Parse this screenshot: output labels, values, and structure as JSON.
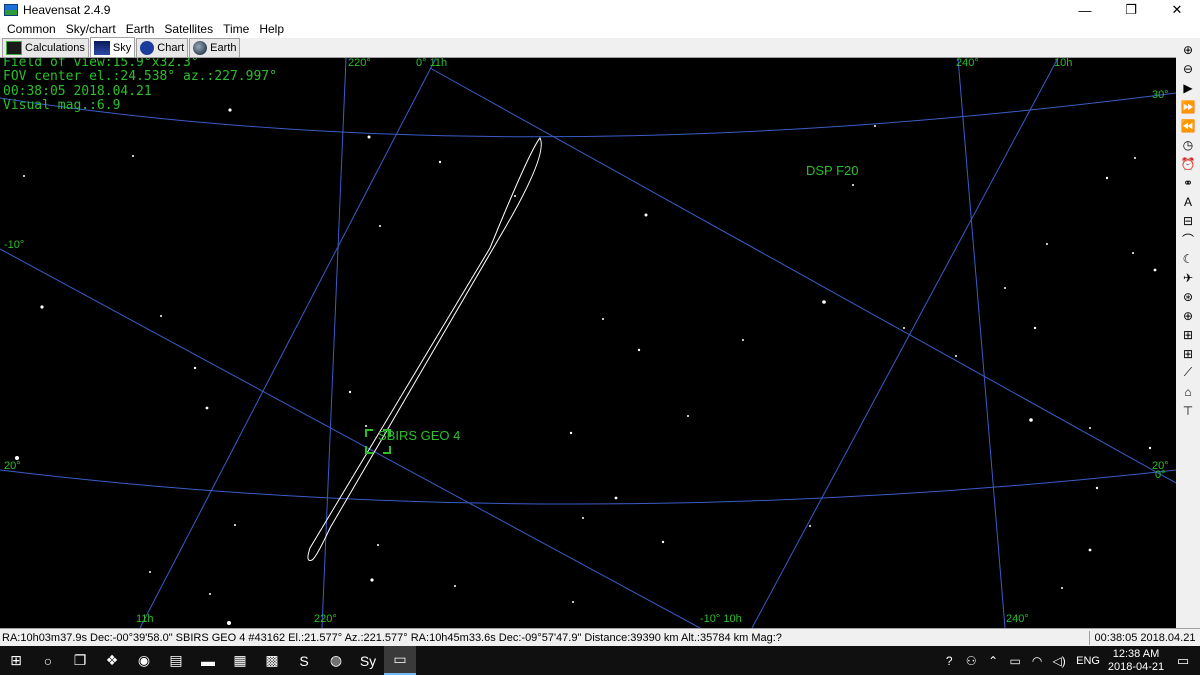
{
  "window": {
    "title": "Heavensat 2.4.9",
    "minimize_glyph": "—",
    "restore_glyph": "❐",
    "close_glyph": "✕"
  },
  "menu": [
    "Common",
    "Sky/chart",
    "Earth",
    "Satellites",
    "Time",
    "Help"
  ],
  "tabs": [
    {
      "label": "Calculations",
      "icon": "calculations-icon"
    },
    {
      "label": "Sky",
      "icon": "sky-icon"
    },
    {
      "label": "Chart",
      "icon": "chart-icon"
    },
    {
      "label": "Earth",
      "icon": "earth-icon"
    }
  ],
  "sky": {
    "info": {
      "fov": "Field of view:15.9°x32.3°",
      "center": "FOV center el.:24.538° az.:227.997°",
      "datetime": "00:38:05 2018.04.21",
      "mag": "Visual mag.:6.9"
    },
    "grid_labels": {
      "top_220": "220°",
      "top_0_11h": "0° 11h",
      "top_240": "240°",
      "top_10h": "10h",
      "right_30": "30°",
      "left_m10": "-10°",
      "left_20": "20°",
      "right_20": "20°",
      "right_0": "0°",
      "bottom_11h": "11h",
      "bottom_220": "220°",
      "bottom_m10_10h": "-10° 10h",
      "bottom_240": "240°"
    },
    "satellites": [
      {
        "name": "SBIRS GEO 4",
        "selected": true
      },
      {
        "name": "DSP F20",
        "selected": false
      }
    ],
    "colors": {
      "background": "#000000",
      "grid": "#3a5cc8",
      "label": "#2bbf2b",
      "track": "#ffffff"
    }
  },
  "toolbar": [
    {
      "icon": "zoom-in-icon",
      "glyph": "⊕"
    },
    {
      "icon": "zoom-out-icon",
      "glyph": "⊖"
    },
    {
      "icon": "play-icon",
      "glyph": "▶"
    },
    {
      "icon": "fast-forward-icon",
      "glyph": "⏩"
    },
    {
      "icon": "rewind-icon",
      "glyph": "⏪"
    },
    {
      "icon": "clock-icon",
      "glyph": "◷"
    },
    {
      "icon": "alarm-icon",
      "glyph": "⏰"
    },
    {
      "icon": "binoculars-icon",
      "glyph": "⚭"
    },
    {
      "icon": "text-icon",
      "glyph": "A"
    },
    {
      "icon": "lock-icon",
      "glyph": "⊟"
    },
    {
      "icon": "arc-icon",
      "glyph": "⌒"
    },
    {
      "icon": "moon-icon",
      "glyph": "☾"
    },
    {
      "icon": "satellite-icon",
      "glyph": "✈"
    },
    {
      "icon": "dish-icon",
      "glyph": "⊛"
    },
    {
      "icon": "globe-icon",
      "glyph": "⊕"
    },
    {
      "icon": "chart-grid-icon",
      "glyph": "⊞"
    },
    {
      "icon": "chart-grid-2-icon",
      "glyph": "⊞"
    },
    {
      "icon": "trail-icon",
      "glyph": "⟋"
    },
    {
      "icon": "horizon-icon",
      "glyph": "⌂"
    },
    {
      "icon": "antenna-icon",
      "glyph": "⊤"
    }
  ],
  "status": {
    "main": "RA:10h03m37.9s Dec:-00°39'58.0\" SBIRS GEO 4 #43162 El.:21.577°  Az.:221.577° RA:10h45m33.6s Dec:-09°57'47.9\" Distance:39390 km  Alt.:35784 km  Mag:?",
    "time": "00:38:05 2018.04.21"
  },
  "taskbar": {
    "apps": [
      {
        "icon": "start-icon",
        "glyph": "⊞"
      },
      {
        "icon": "search-icon",
        "glyph": "○"
      },
      {
        "icon": "task-view-icon",
        "glyph": "❐"
      },
      {
        "icon": "dropbox-icon",
        "glyph": "❖"
      },
      {
        "icon": "app-icon-1",
        "glyph": "◉"
      },
      {
        "icon": "notepad-icon",
        "glyph": "▤"
      },
      {
        "icon": "folder-icon",
        "glyph": "▬"
      },
      {
        "icon": "app-icon-2",
        "glyph": "▦"
      },
      {
        "icon": "app-icon-3",
        "glyph": "▩"
      },
      {
        "icon": "skype-icon",
        "glyph": "S"
      },
      {
        "icon": "firefox-icon",
        "glyph": "◍"
      },
      {
        "icon": "stellarium-icon",
        "glyph": "Sy"
      },
      {
        "icon": "heavensat-icon",
        "glyph": "▭"
      }
    ],
    "tray": {
      "help_glyph": "?",
      "people_glyph": "⚇",
      "chevron_glyph": "⌃",
      "battery_glyph": "▭",
      "wifi_glyph": "◠",
      "volume_glyph": "◁)",
      "lang": "ENG",
      "time": "12:38 AM",
      "date": "2018-04-21",
      "notif_glyph": "▭"
    }
  }
}
